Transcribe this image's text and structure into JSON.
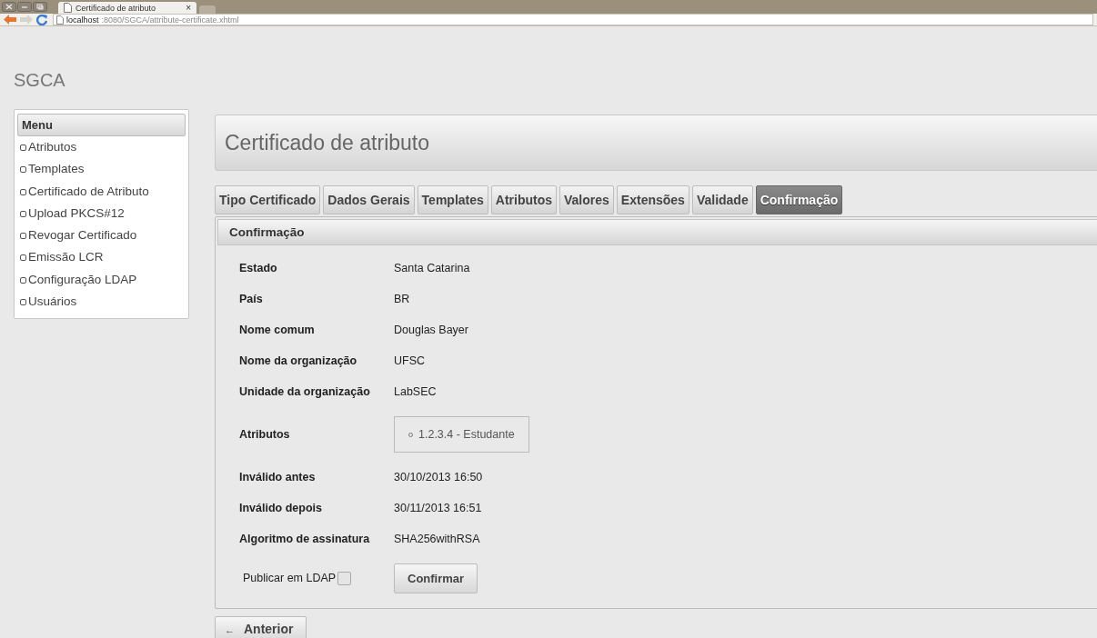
{
  "browser": {
    "tab_title": "Certificado de atributo",
    "tab_close": "×",
    "url_host": "localhost",
    "url_path": ":8080/SGCA/attribute-certificate.xhtml"
  },
  "app_title": "SGCA",
  "sidebar": {
    "title": "Menu",
    "items": [
      {
        "label": "Atributos"
      },
      {
        "label": "Templates"
      },
      {
        "label": "Certificado de Atributo"
      },
      {
        "label": "Upload PKCS#12"
      },
      {
        "label": "Revogar Certificado"
      },
      {
        "label": "Emissão LCR"
      },
      {
        "label": "Configuração LDAP"
      },
      {
        "label": "Usuários"
      }
    ]
  },
  "page_title": "Certificado de atributo",
  "tabs": [
    {
      "label": "Tipo Certificado",
      "selected": false
    },
    {
      "label": "Dados Gerais",
      "selected": false
    },
    {
      "label": "Templates",
      "selected": false
    },
    {
      "label": "Atributos",
      "selected": false
    },
    {
      "label": "Valores",
      "selected": false
    },
    {
      "label": "Extensões",
      "selected": false
    },
    {
      "label": "Validade",
      "selected": false
    },
    {
      "label": "Confirmação",
      "selected": true
    }
  ],
  "panel": {
    "title": "Confirmação",
    "fields": [
      {
        "kind": "text",
        "label": "Estado",
        "value": "Santa Catarina"
      },
      {
        "kind": "text",
        "label": "País",
        "value": "BR"
      },
      {
        "kind": "text",
        "label": "Nome comum",
        "value": "Douglas Bayer"
      },
      {
        "kind": "text",
        "label": "Nome da organização",
        "value": "UFSC"
      },
      {
        "kind": "text",
        "label": "Unidade da organização",
        "value": "LabSEC"
      },
      {
        "kind": "list",
        "label": "Atributos",
        "items": [
          "1.2.3.4 - Estudante"
        ]
      },
      {
        "kind": "text",
        "label": "Inválido antes",
        "value": "30/10/2013 16:50"
      },
      {
        "kind": "text",
        "label": "Inválido depois",
        "value": "30/11/2013 16:51"
      },
      {
        "kind": "text",
        "label": "Algoritmo de assinatura",
        "value": "SHA256withRSA"
      }
    ],
    "publish": {
      "label": "Publicar em LDAP",
      "checked": false
    },
    "confirm_button": "Confirmar"
  },
  "back_button": {
    "arrow": "←",
    "label": "Anterior"
  }
}
